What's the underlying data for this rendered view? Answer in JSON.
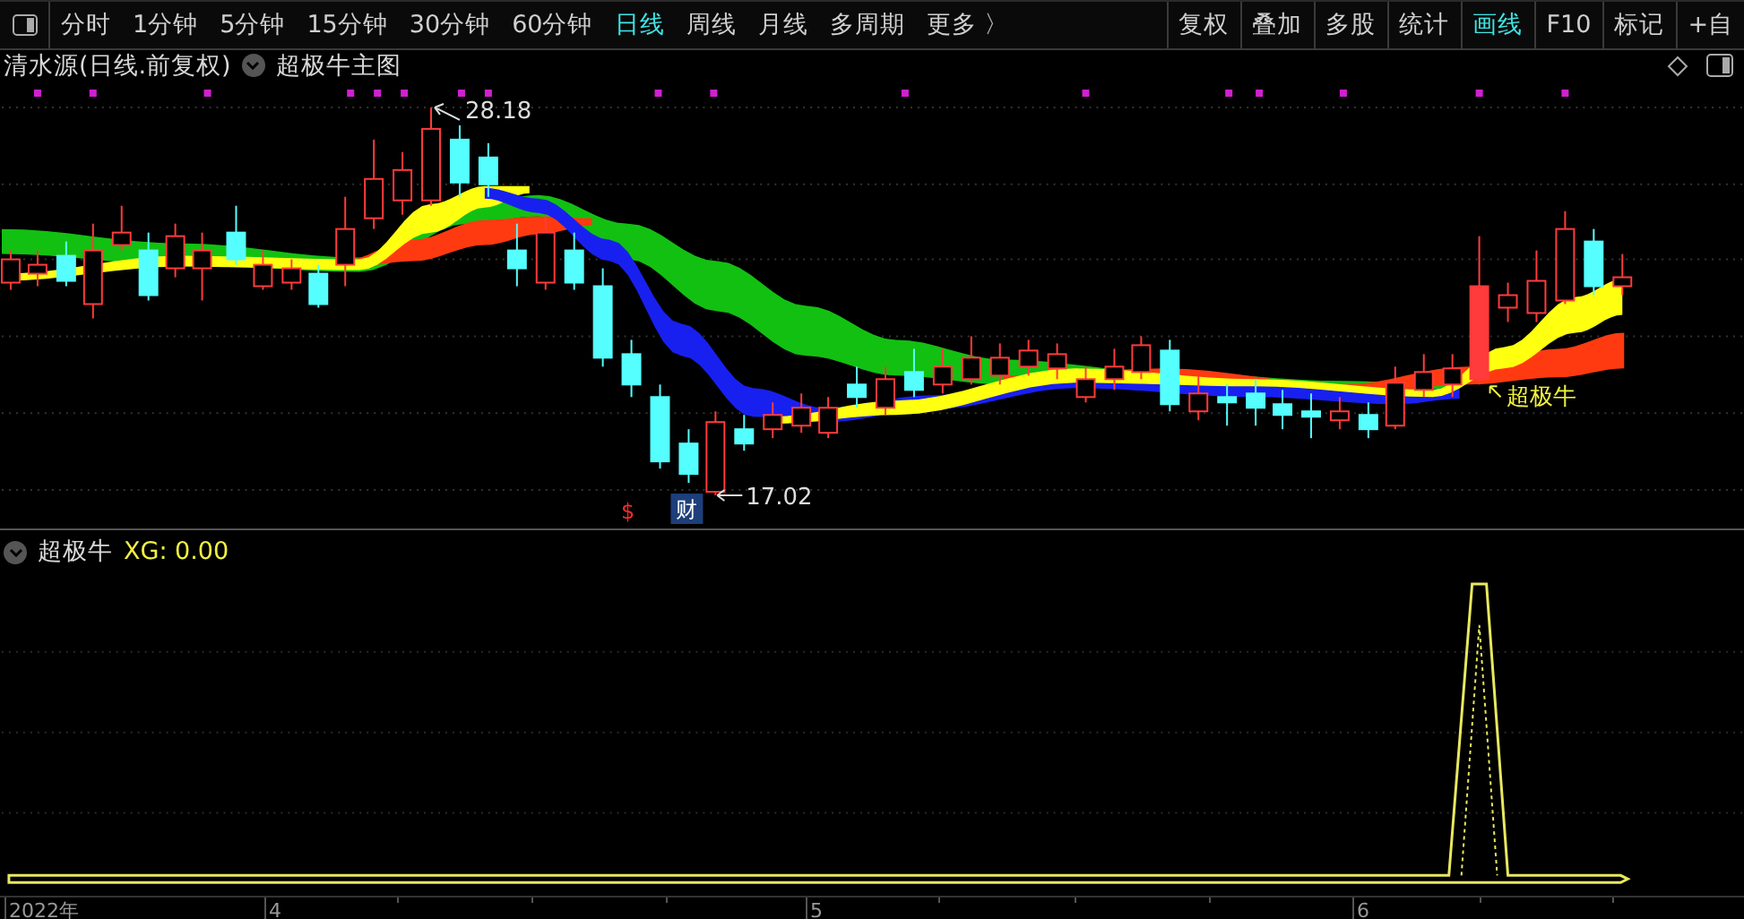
{
  "toolbar": {
    "periods": [
      {
        "label": "分时",
        "selected": false
      },
      {
        "label": "1分钟",
        "selected": false
      },
      {
        "label": "5分钟",
        "selected": false
      },
      {
        "label": "15分钟",
        "selected": false
      },
      {
        "label": "30分钟",
        "selected": false
      },
      {
        "label": "60分钟",
        "selected": false
      },
      {
        "label": "日线",
        "selected": true
      },
      {
        "label": "周线",
        "selected": false
      },
      {
        "label": "月线",
        "selected": false
      },
      {
        "label": "多周期",
        "selected": false
      }
    ],
    "more": "更多 〉",
    "tools": [
      {
        "label": "复权",
        "selected": false
      },
      {
        "label": "叠加",
        "selected": false
      },
      {
        "label": "多股",
        "selected": false
      },
      {
        "label": "统计",
        "selected": false
      },
      {
        "label": "画线",
        "selected": true
      },
      {
        "label": "F10",
        "selected": false
      },
      {
        "label": "标记",
        "selected": false
      },
      {
        "label": "+自",
        "selected": false
      }
    ]
  },
  "main_chart": {
    "title": "清水源(日线.前复权)",
    "indicator": "超极牛主图",
    "high_label": "28.18",
    "low_label": "17.02",
    "signal_label": "超极牛",
    "marks": [
      {
        "text": "$",
        "kind": "dollar"
      },
      {
        "text": "财",
        "kind": "finance"
      }
    ]
  },
  "sub_chart": {
    "name": "超极牛",
    "reading": "XG: 0.00"
  },
  "axis": {
    "labels": [
      "2022年",
      "4",
      "5",
      "6"
    ]
  }
}
